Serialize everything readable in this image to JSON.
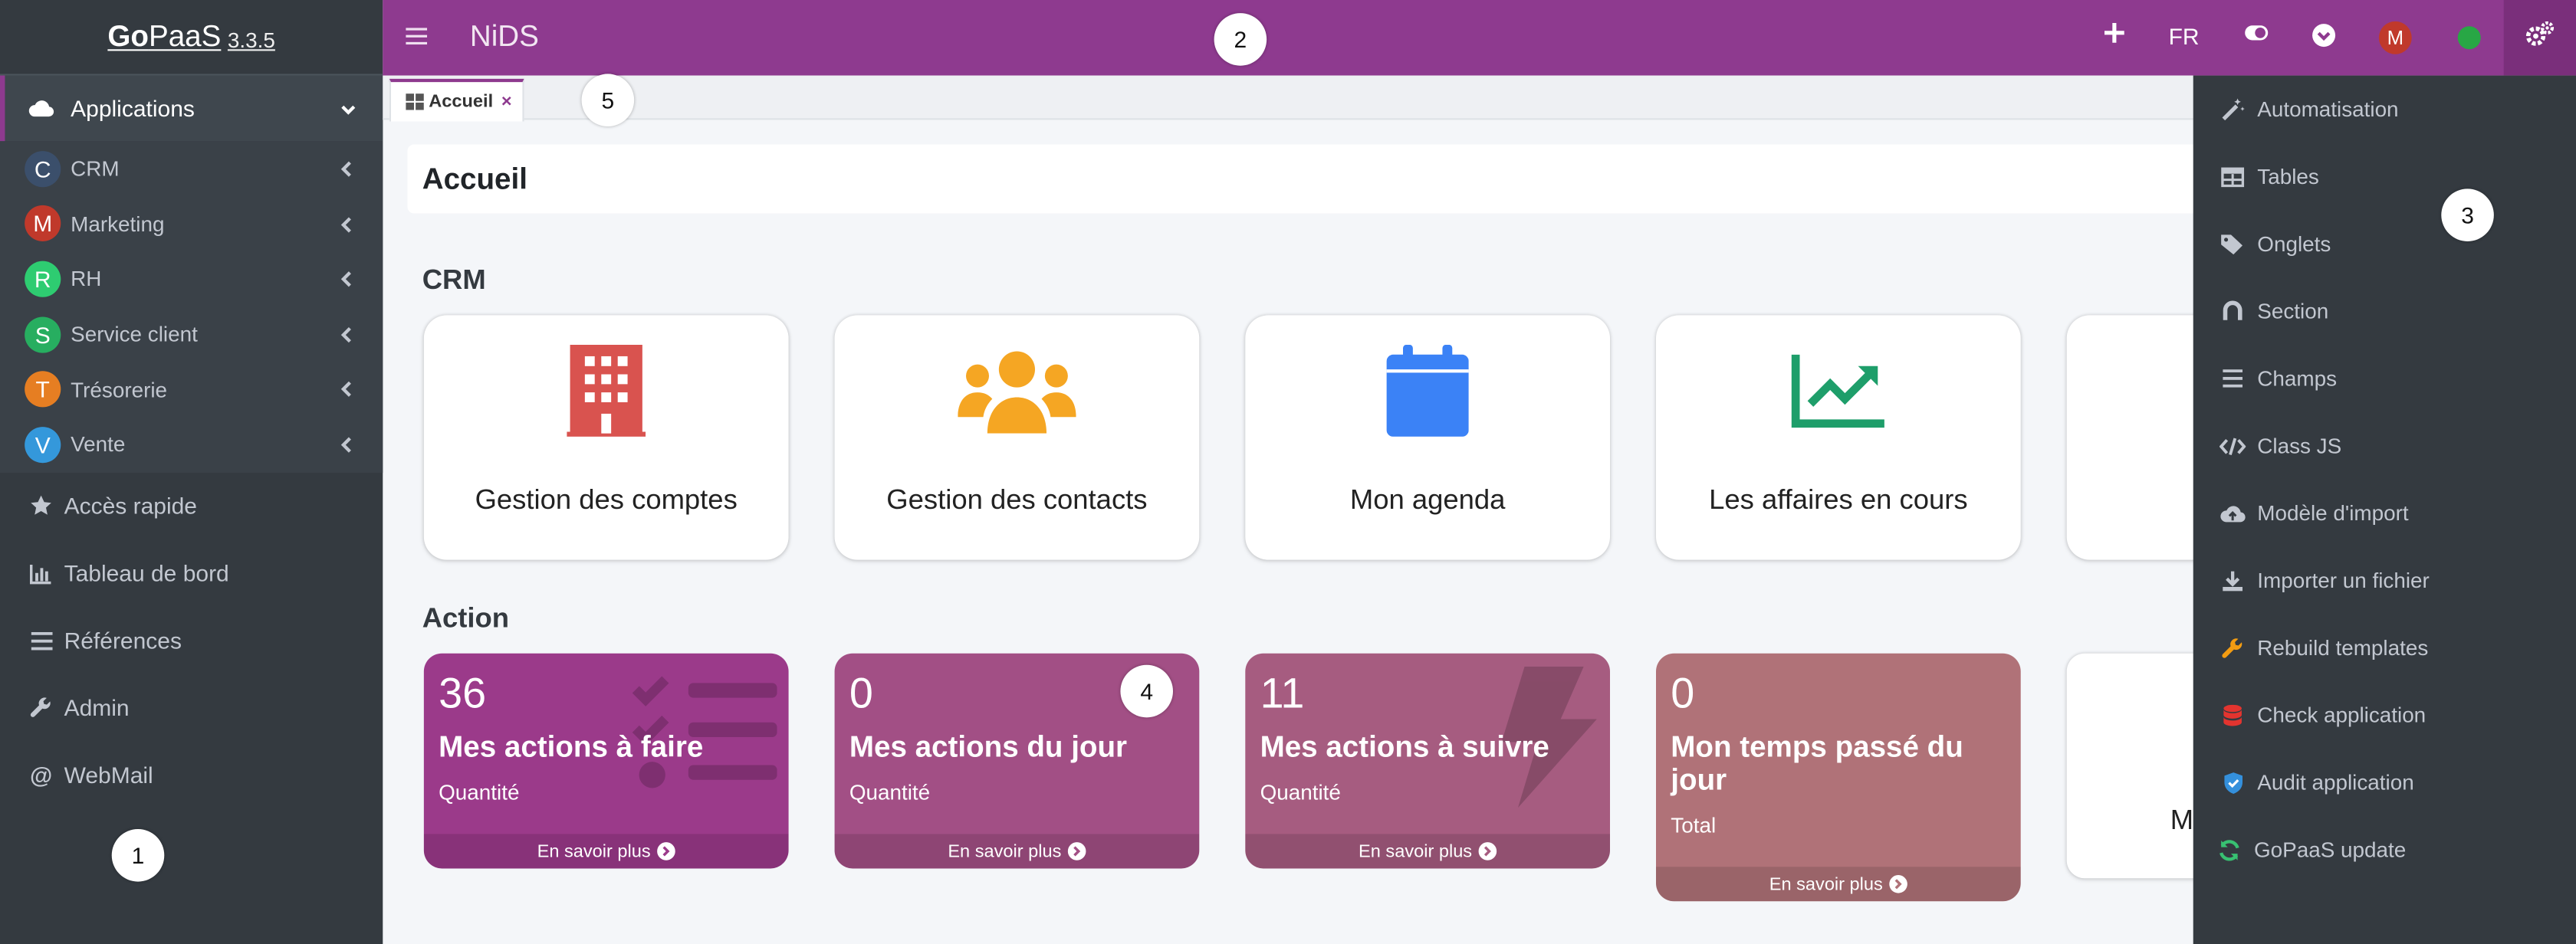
{
  "brand": {
    "name_bold": "Go",
    "name_rest": "PaaS",
    "version": "3.3.5"
  },
  "sidebar": {
    "active": {
      "label": "Applications",
      "icon": "cloud-icon"
    },
    "apps": [
      {
        "letter": "C",
        "label": "CRM",
        "color": "#3b4f6b"
      },
      {
        "letter": "M",
        "label": "Marketing",
        "color": "#c0392b"
      },
      {
        "letter": "R",
        "label": "RH",
        "color": "#2ecc71"
      },
      {
        "letter": "S",
        "label": "Service client",
        "color": "#27ae60"
      },
      {
        "letter": "T",
        "label": "Trésorerie",
        "color": "#e67e22"
      },
      {
        "letter": "V",
        "label": "Vente",
        "color": "#3498db"
      }
    ],
    "items": [
      {
        "label": "Accès rapide",
        "icon": "star-icon"
      },
      {
        "label": "Tableau de bord",
        "icon": "chart-icon"
      },
      {
        "label": "Références",
        "icon": "list-icon"
      },
      {
        "label": "Admin",
        "icon": "wrench-icon"
      },
      {
        "label": "WebMail",
        "icon": "at-icon"
      }
    ]
  },
  "topbar": {
    "title": "NiDS",
    "lang": "FR",
    "avatar_letter": "M",
    "icons": [
      "menu-icon",
      "plus-icon",
      "toggle-icon",
      "chevron-circle-icon",
      "avatar",
      "status-dot",
      "cogs-icon"
    ]
  },
  "tabs": [
    {
      "label": "Accueil",
      "close": "×",
      "icon": "grid-icon"
    }
  ],
  "page": {
    "title": "Accueil"
  },
  "sections": {
    "crm": "CRM",
    "action": "Action"
  },
  "crm_cards": [
    {
      "label": "Gestion des comptes",
      "icon": "building-icon",
      "color": "#d9534f"
    },
    {
      "label": "Gestion des contacts",
      "icon": "users-icon",
      "color": "#f5a623"
    },
    {
      "label": "Mon agenda",
      "icon": "calendar-icon",
      "color": "#3b82f6"
    },
    {
      "label": "Les affaires en cours",
      "icon": "trend-chart-icon",
      "color": "#1e9e6a"
    }
  ],
  "action_boxes": [
    {
      "value": "36",
      "title": "Mes actions à faire",
      "subtitle": "Quantité",
      "footer": "En savoir plus",
      "color": "#9b3a8a",
      "icon": "tasks-icon"
    },
    {
      "value": "0",
      "title": "Mes actions du jour",
      "subtitle": "Quantité",
      "footer": "En savoir plus",
      "color": "#a24f85",
      "icon": "none"
    },
    {
      "value": "11",
      "title": "Mes actions à suivre",
      "subtitle": "Quantité",
      "footer": "En savoir plus",
      "color": "#a65c80",
      "icon": "bolt-icon"
    },
    {
      "value": "0",
      "title": "Mon temps passé du jour",
      "subtitle": "Total",
      "footer": "En savoir plus",
      "color": "#b07278",
      "icon": "none"
    }
  ],
  "partial_card_text": "M",
  "dropdown": [
    {
      "label": "Automatisation",
      "icon": "magic-wand-icon",
      "color": "#c2c7d0"
    },
    {
      "label": "Tables",
      "icon": "table-icon",
      "color": "#c2c7d0"
    },
    {
      "label": "Onglets",
      "icon": "tags-icon",
      "color": "#c2c7d0"
    },
    {
      "label": "Section",
      "icon": "magnet-icon",
      "color": "#c2c7d0"
    },
    {
      "label": "Champs",
      "icon": "bars-icon",
      "color": "#c2c7d0"
    },
    {
      "label": "Class JS",
      "icon": "code-icon",
      "color": "#c2c7d0"
    },
    {
      "label": "Modèle d'import",
      "icon": "cloud-upload-icon",
      "color": "#c2c7d0"
    },
    {
      "label": "Importer un fichier",
      "icon": "download-icon",
      "color": "#c2c7d0"
    },
    {
      "label": "Rebuild templates",
      "icon": "wrench-icon",
      "color": "#f39c12"
    },
    {
      "label": "Check application",
      "icon": "database-icon",
      "color": "#e3342f"
    },
    {
      "label": "Audit application",
      "icon": "shield-icon",
      "color": "#3490dc"
    },
    {
      "label": "GoPaaS update",
      "icon": "sync-icon",
      "color": "#38c172"
    }
  ],
  "markers": [
    "1",
    "2",
    "3",
    "4",
    "5"
  ]
}
